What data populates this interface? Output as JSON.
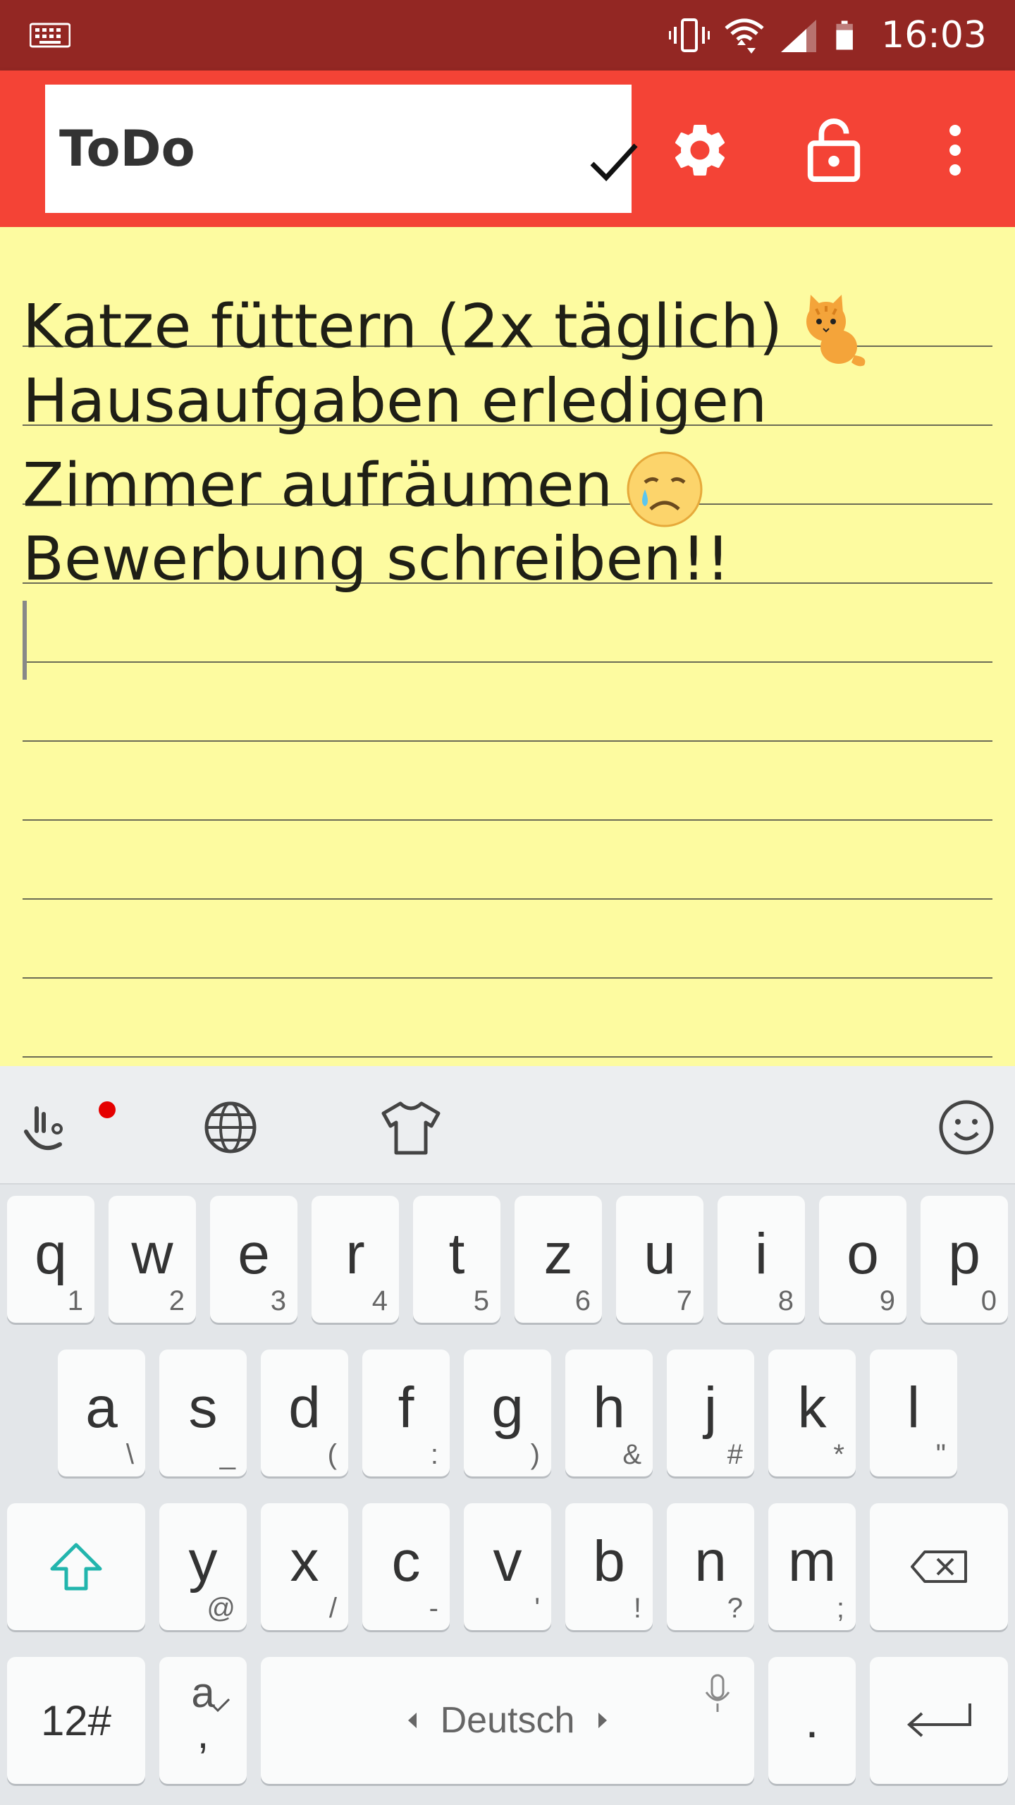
{
  "status_bar": {
    "time": "16:03",
    "icons": [
      "keyboard-icon",
      "vibrate-icon",
      "wifi-icon",
      "signal-icon",
      "battery-icon"
    ]
  },
  "toolbar": {
    "title_value": "ToDo",
    "icons": [
      "check-icon",
      "gear-icon",
      "lock-open-icon",
      "more-vert-icon"
    ],
    "color": "#f44336"
  },
  "note": {
    "background": "#fdfba0",
    "lines": [
      {
        "text": "Katze füttern (2x täglich)",
        "emoji": "cat-emoji"
      },
      {
        "text": "Hausaufgaben erledigen",
        "emoji": ""
      },
      {
        "text": "Zimmer aufräumen",
        "emoji": "sad-face-emoji"
      },
      {
        "text": "Bewerbung schreiben!!",
        "emoji": ""
      }
    ]
  },
  "keyboard": {
    "toolbar_icons": [
      "gesture-icon",
      "globe-icon",
      "theme-shirt-icon",
      "emoji-icon"
    ],
    "row1": [
      {
        "k": "q",
        "s": "1"
      },
      {
        "k": "w",
        "s": "2"
      },
      {
        "k": "e",
        "s": "3"
      },
      {
        "k": "r",
        "s": "4"
      },
      {
        "k": "t",
        "s": "5"
      },
      {
        "k": "z",
        "s": "6"
      },
      {
        "k": "u",
        "s": "7"
      },
      {
        "k": "i",
        "s": "8"
      },
      {
        "k": "o",
        "s": "9"
      },
      {
        "k": "p",
        "s": "0"
      }
    ],
    "row2": [
      {
        "k": "a",
        "s": "\\"
      },
      {
        "k": "s",
        "s": "_"
      },
      {
        "k": "d",
        "s": "("
      },
      {
        "k": "f",
        "s": ":"
      },
      {
        "k": "g",
        "s": ")"
      },
      {
        "k": "h",
        "s": "&"
      },
      {
        "k": "j",
        "s": "#"
      },
      {
        "k": "k",
        "s": "*"
      },
      {
        "k": "l",
        "s": "\""
      }
    ],
    "row3": [
      {
        "k": "y",
        "s": "@"
      },
      {
        "k": "x",
        "s": "/"
      },
      {
        "k": "c",
        "s": "-"
      },
      {
        "k": "v",
        "s": "'"
      },
      {
        "k": "b",
        "s": "!"
      },
      {
        "k": "n",
        "s": "?"
      },
      {
        "k": "m",
        "s": ";"
      }
    ],
    "symbols_label": "12#",
    "accent_key_top": "a",
    "accent_key_sub": ",",
    "space_label": "Deutsch",
    "period_label": "."
  }
}
